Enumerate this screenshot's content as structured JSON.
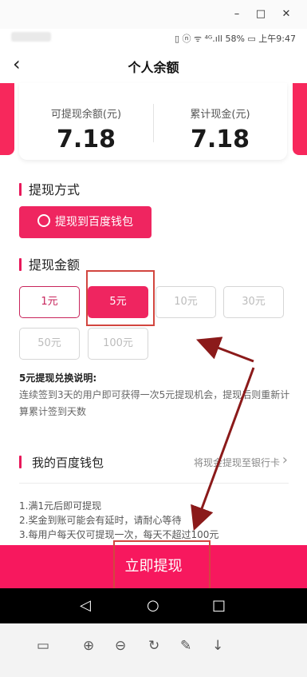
{
  "window": {
    "minimize": "–",
    "maximize": "□",
    "close": "✕"
  },
  "status": {
    "right": "▯ ⓝ ᯤ ⁴ᴳ.ıll 58% ▭ 上午9:47"
  },
  "header": {
    "back": "‹",
    "title": "个人余额"
  },
  "balance": {
    "withdrawable_label": "可提现余额(元)",
    "withdrawable_value": "7.18",
    "cumulative_label": "累计现金(元)",
    "cumulative_value": "7.18"
  },
  "method": {
    "section_title": "提现方式",
    "button_label": "提现到百度钱包"
  },
  "amount": {
    "section_title": "提现金额",
    "options": [
      "1元",
      "5元",
      "10元",
      "30元",
      "50元",
      "100元"
    ]
  },
  "notes": {
    "title": "5元提现兑换说明:",
    "text": "连续签到3天的用户即可获得一次5元提现机会，提现后则重新计算累计签到天数"
  },
  "wallet": {
    "name": "我的百度钱包",
    "hint": "将现金提现至银行卡",
    "chevron": "›"
  },
  "rules": [
    "1.满1元后即可提现",
    "2.奖金到账可能会有延时，请耐心等待",
    "3.每用户每天仅可提现一次，每天不超过100元"
  ],
  "withdraw_button": "立即提现",
  "navbar": {
    "back": "◁",
    "home": "○",
    "recent": "□"
  },
  "toolbar": {
    "layout": "▭",
    "zoom_in": "⊕",
    "zoom_out": "⊖",
    "rotate": "↻",
    "edit": "✎",
    "download": "↓"
  },
  "colors": {
    "accent": "#ef2560",
    "highlight_box": "#d2463f",
    "arrow": "#8b1a1a"
  }
}
